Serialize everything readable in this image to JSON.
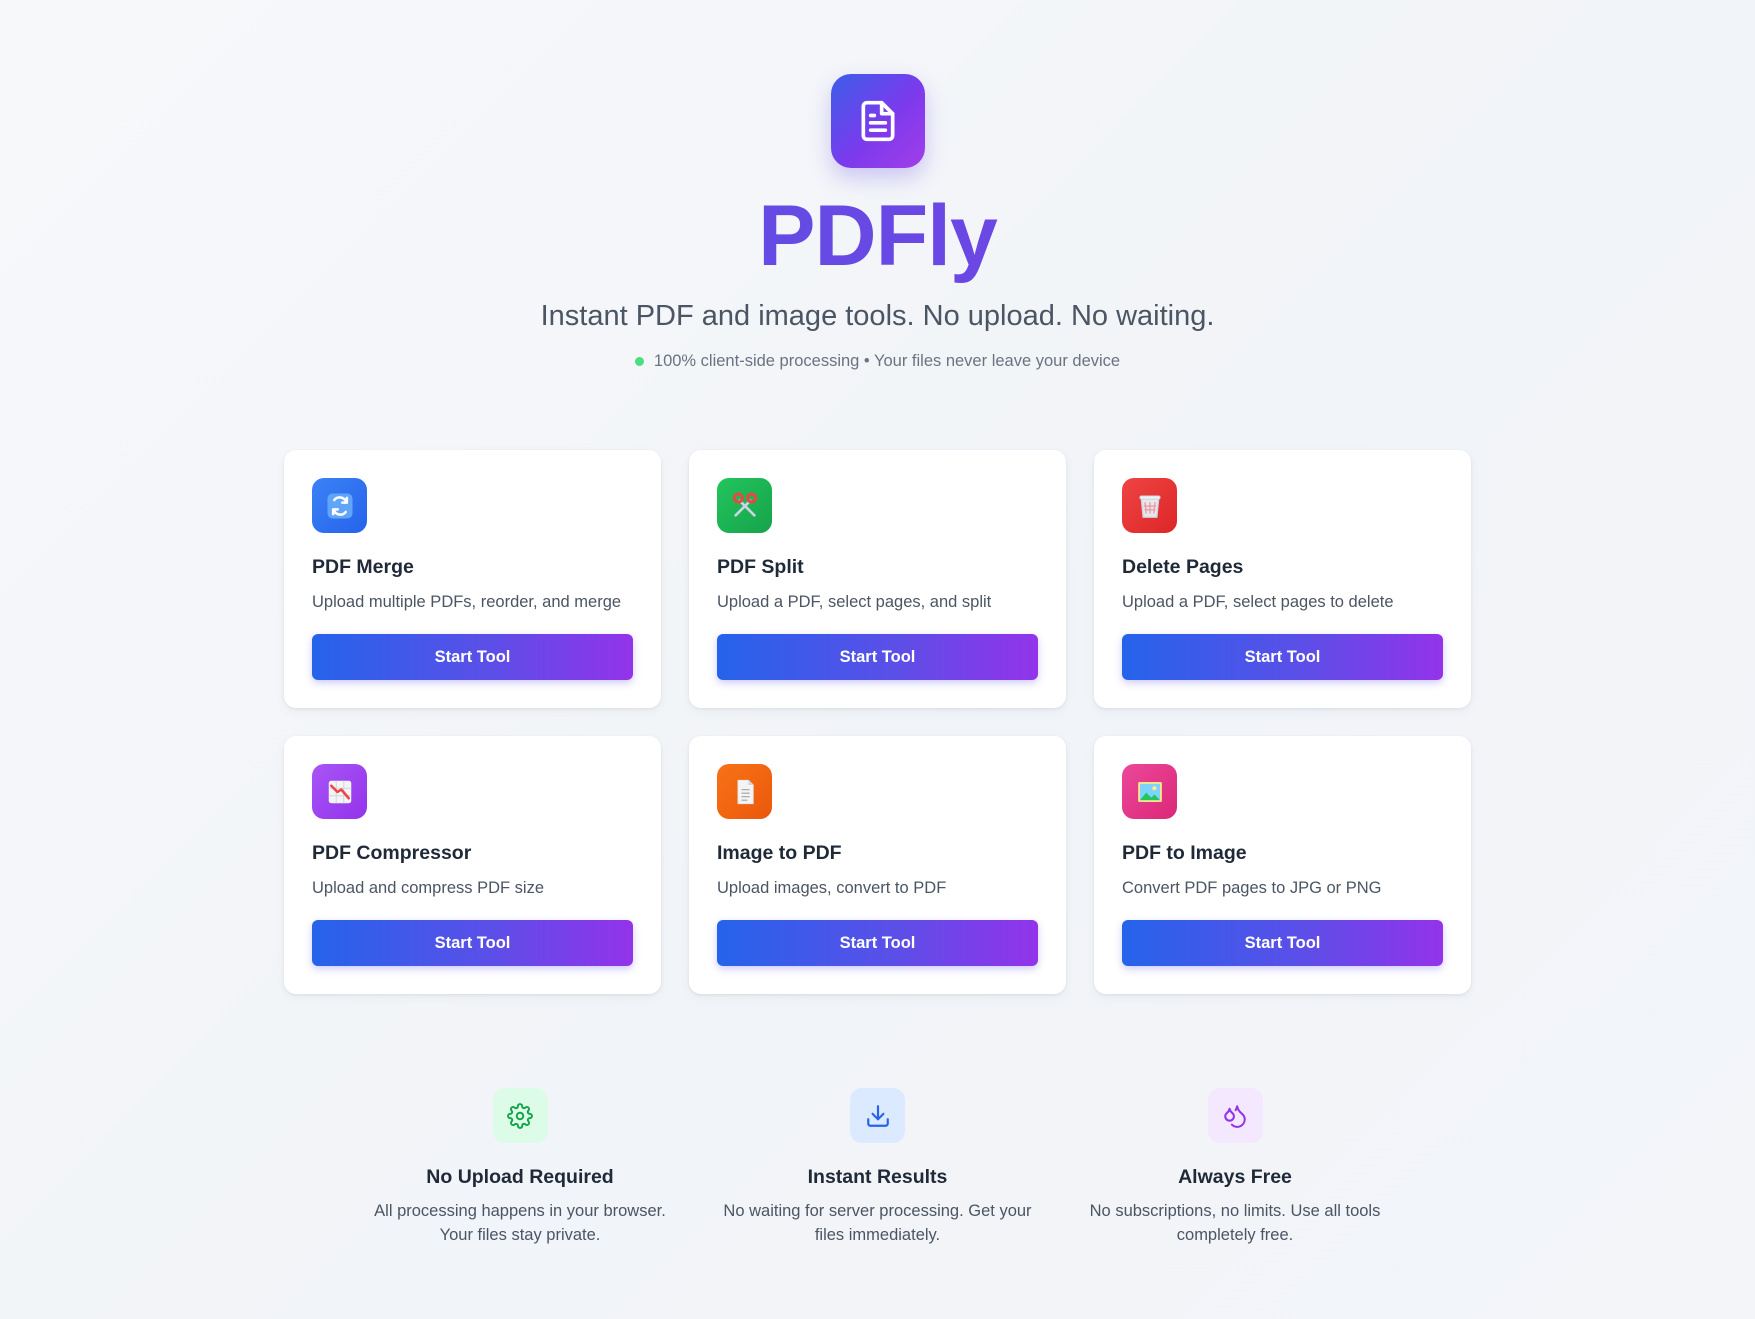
{
  "header": {
    "logo_icon": "document-icon",
    "title": "PDFly",
    "tagline": "Instant PDF and image tools. No upload. No waiting.",
    "privacy_note": "100% client-side processing • Your files never leave your device",
    "privacy_dot_color": "#4ade80"
  },
  "tools": [
    {
      "title": "PDF Merge",
      "description": "Upload multiple PDFs, reorder, and merge",
      "button": "Start Tool",
      "icon": "refresh-icon",
      "color": "#3b82f6"
    },
    {
      "title": "PDF Split",
      "description": "Upload a PDF, select pages, and split",
      "button": "Start Tool",
      "icon": "scissors-icon",
      "color": "#22c55e"
    },
    {
      "title": "Delete Pages",
      "description": "Upload a PDF, select pages to delete",
      "button": "Start Tool",
      "icon": "wastebasket-icon",
      "color": "#ef4444"
    },
    {
      "title": "PDF Compressor",
      "description": "Upload and compress PDF size",
      "button": "Start Tool",
      "icon": "chart-decreasing-icon",
      "color": "#a855f7"
    },
    {
      "title": "Image to PDF",
      "description": "Upload images, convert to PDF",
      "button": "Start Tool",
      "icon": "page-icon",
      "color": "#f97316"
    },
    {
      "title": "PDF to Image",
      "description": "Convert PDF pages to JPG or PNG",
      "button": "Start Tool",
      "icon": "landscape-picture-icon",
      "color": "#ec4899"
    }
  ],
  "features": [
    {
      "title": "No Upload Required",
      "description": "All processing happens in your browser. Your files stay private.",
      "icon": "gear-icon",
      "color": "#16a34a"
    },
    {
      "title": "Instant Results",
      "description": "No waiting for server processing. Get your files immediately.",
      "icon": "download-icon",
      "color": "#2563eb"
    },
    {
      "title": "Always Free",
      "description": "No subscriptions, no limits. Use all tools completely free.",
      "icon": "droplets-icon",
      "color": "#9333ea"
    }
  ],
  "theme": {
    "accent_start": "#2563eb",
    "accent_end": "#9333ea",
    "title_color": "#5b4fe3"
  }
}
